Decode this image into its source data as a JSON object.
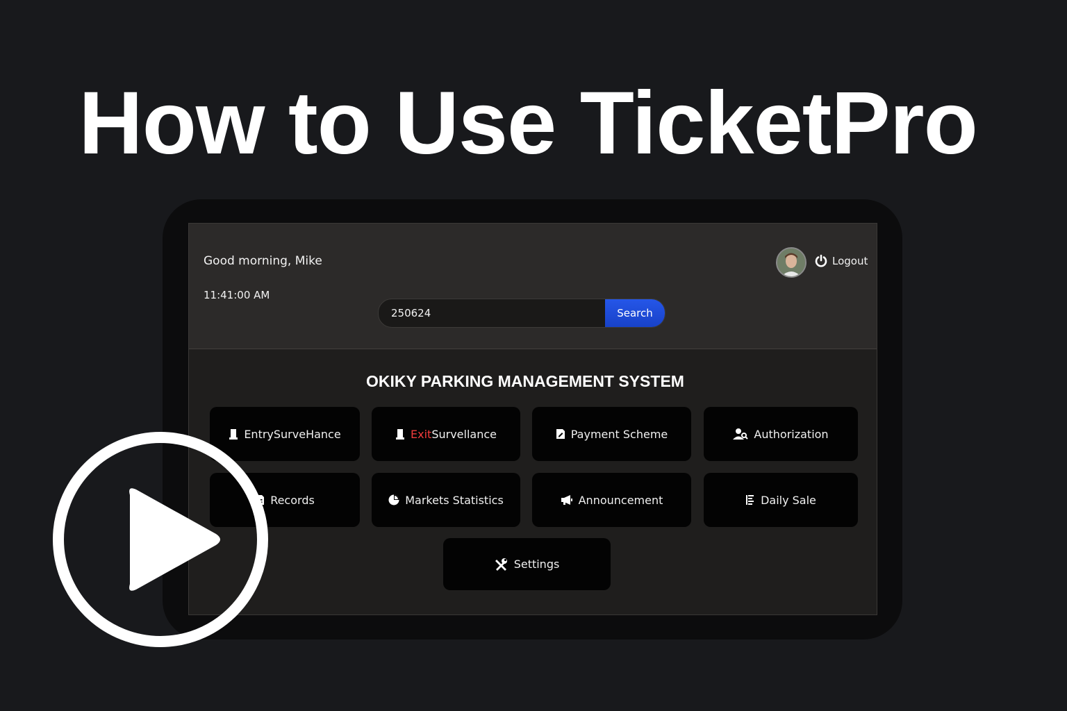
{
  "headline": "How to Use TicketPro",
  "header": {
    "greeting": "Good morning, Mike",
    "time": "11:41:00 AM",
    "logout_label": "Logout"
  },
  "search": {
    "value": "250624",
    "button_label": "Search"
  },
  "system_title": "OKIKY PARKING MANAGEMENT SYSTEM",
  "menu": {
    "entry": "EntrySurveHance",
    "exit_prefix": "Exit",
    "exit_suffix": "Survellance",
    "payment": "Payment Scheme",
    "authorization": "Authorization",
    "records": "Records",
    "markets": "Markets Statistics",
    "announcement": "Announcement",
    "daily_sale": "Daily Sale",
    "settings": "Settings"
  },
  "colors": {
    "background": "#18191c",
    "accent_blue": "#1f4fe0",
    "exit_red": "#f23b3b",
    "tile": "#030303"
  },
  "icons": [
    "post-icon",
    "edit-doc-icon",
    "user-key-icon",
    "records-icon",
    "pie-chart-icon",
    "megaphone-icon",
    "list-icon",
    "tools-icon",
    "power-icon",
    "play-icon"
  ]
}
